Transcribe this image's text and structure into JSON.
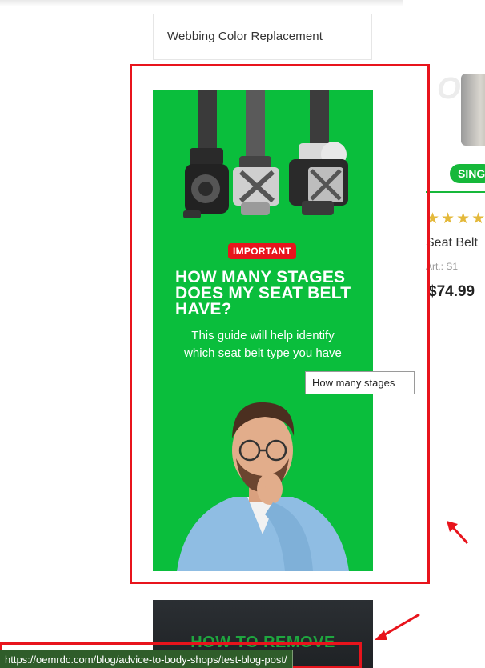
{
  "sidebar": {
    "menu_item_label": "Webbing Color Replacement"
  },
  "banner": {
    "badge": "IMPORTANT",
    "title": "HOW MANY STAGES DOES MY SEAT BELT HAVE?",
    "subtitle_line1": "This guide will help identify",
    "subtitle_line2": "which seat belt type you have",
    "tooltip": "How many stages",
    "bg_color": "#0abe3c",
    "badge_color": "#e8141c"
  },
  "product": {
    "badge": "SING",
    "stars": "★★★★",
    "name": "Seat Belt",
    "article": "Art.: S1",
    "price": "$74.99",
    "watermark": "OC"
  },
  "banner2": {
    "title": "HOW TO REMOVE"
  },
  "status_bar": {
    "url": "https://oemrdc.com/blog/advice-to-body-shops/test-blog-post/"
  },
  "annotations": {
    "highlight_color": "#e8141c"
  }
}
